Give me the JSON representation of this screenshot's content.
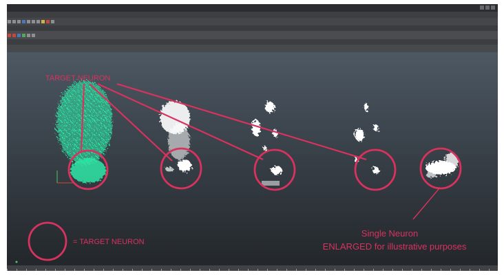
{
  "annotations": {
    "target_label": "TARGET NEURON",
    "legend_label": "= TARGET NEURON",
    "single_neuron_label": "Single Neuron",
    "enlarged_label": "ENLARGED for illustrative purposes"
  },
  "colors": {
    "annotation": "#d8325e",
    "highlight_cloud": "#2ee6a6",
    "neuron_white": "#ffffff",
    "viewport_top": "#4d5863",
    "viewport_bottom": "#23272b"
  },
  "icons": [
    "file-icon",
    "save-icon",
    "undo-icon",
    "select-icon",
    "move-icon",
    "rotate-icon",
    "scale-icon",
    "snap-icon",
    "render-icon",
    "camera-icon",
    "light-icon",
    "grid-icon"
  ]
}
